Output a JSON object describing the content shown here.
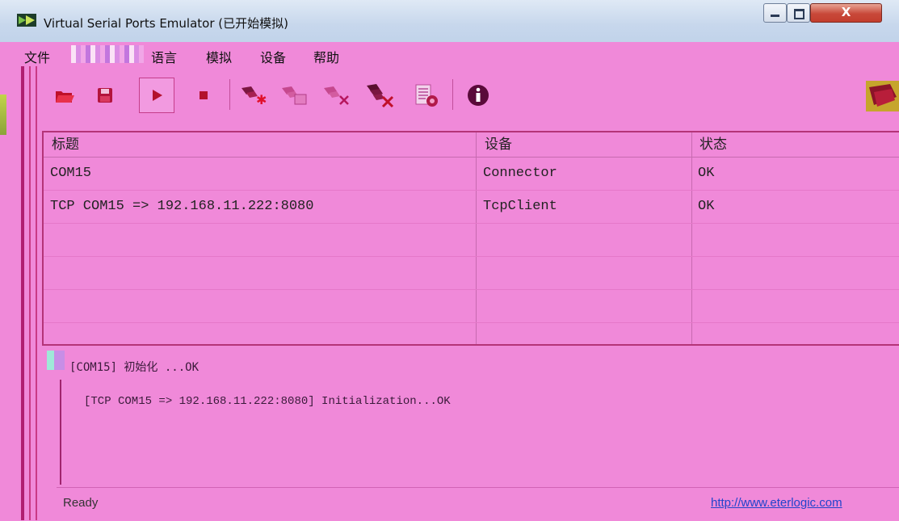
{
  "window": {
    "title": "Virtual Serial Ports Emulator (已开始模拟)",
    "close_glyph": "X"
  },
  "menu": {
    "items": [
      "文件",
      "语言",
      "模拟",
      "设备",
      "帮助"
    ]
  },
  "toolbar": {
    "buttons": [
      {
        "name": "open-icon"
      },
      {
        "name": "save-icon"
      },
      {
        "name": "play-icon",
        "pressed": true
      },
      {
        "name": "stop-icon"
      },
      {
        "name": "new-device-icon"
      },
      {
        "name": "device-properties-icon"
      },
      {
        "name": "delete-device-icon"
      },
      {
        "name": "delete-all-devices-icon"
      },
      {
        "name": "device-list-icon"
      },
      {
        "name": "info-icon"
      }
    ]
  },
  "table": {
    "headers": [
      "标题",
      "设备",
      "状态"
    ],
    "rows": [
      {
        "title": "COM15",
        "device": "Connector",
        "status": "OK"
      },
      {
        "title": "TCP COM15 => 192.168.11.222:8080",
        "device": "TcpClient",
        "status": "OK"
      }
    ]
  },
  "log": {
    "lines": [
      "[COM15] 初始化 ...OK",
      "[TCP COM15 => 192.168.11.222:8080] Initialization...OK"
    ]
  },
  "status": {
    "text": "Ready",
    "link": "http://www.eterlogic.com"
  },
  "colors": {
    "background": "#f089d9",
    "accent_border": "#b43478",
    "link": "#2244cc"
  }
}
